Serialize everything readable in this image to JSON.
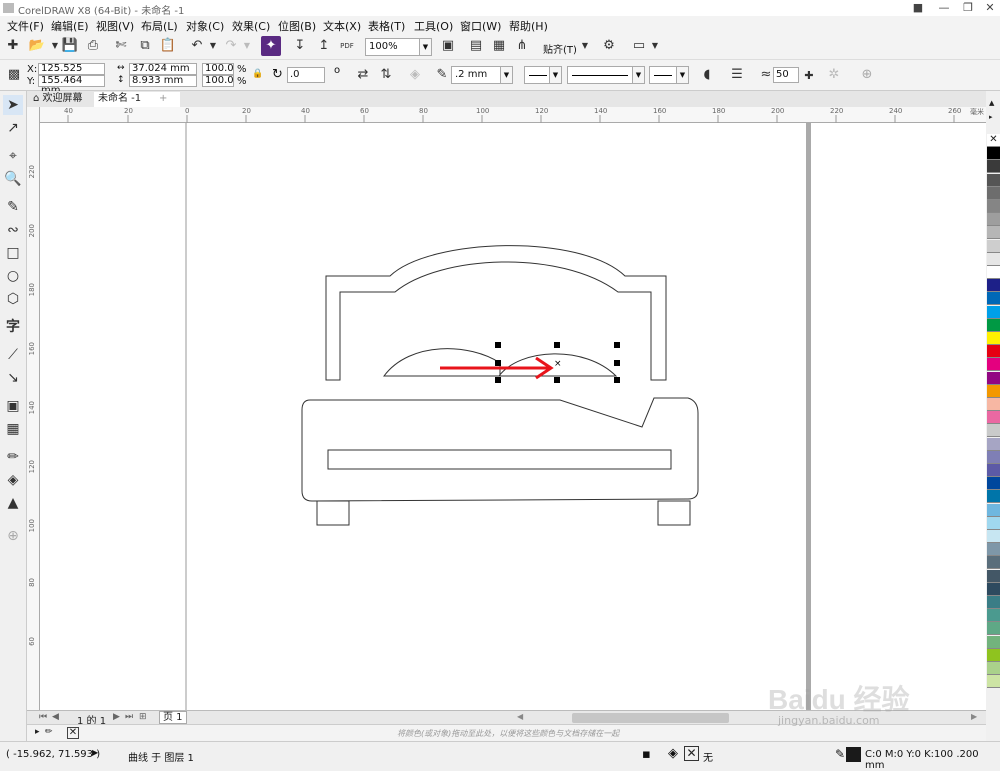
{
  "window": {
    "title": "CorelDRAW X8 (64-Bit) - 未命名 -1"
  },
  "menu": [
    "文件(F)",
    "编辑(E)",
    "视图(V)",
    "布局(L)",
    "对象(C)",
    "效果(C)",
    "位图(B)",
    "文本(X)",
    "表格(T)",
    "工具(O)",
    "窗口(W)",
    "帮助(H)"
  ],
  "toolbar": {
    "zoom": "100%",
    "snap_label": "贴齐(T)",
    "pdf_label": "PDF"
  },
  "propbar": {
    "x": "125.525 mm",
    "y": "155.464 mm",
    "w": "37.024 mm",
    "h": "8.933 mm",
    "sx": "100.0",
    "sy": "100.0",
    "pct": "%",
    "xlabel": "X:",
    "ylabel": "Y:",
    "rotation": ".0",
    "deg": "o",
    "outline_width": ".2 mm",
    "smooth": "50"
  },
  "tabs": {
    "welcome": "欢迎屏幕",
    "doc": "未命名 -1",
    "add": "+"
  },
  "ruler": {
    "h_ticks": [
      "40",
      "20",
      "0",
      "20",
      "40",
      "60",
      "80",
      "100",
      "120",
      "140",
      "160",
      "180",
      "200",
      "220",
      "240",
      "260"
    ],
    "v_ticks": [
      "220",
      "200",
      "180",
      "160",
      "140",
      "120",
      "100",
      "80",
      "60"
    ],
    "unit": "毫米"
  },
  "pagenav": {
    "page_of": "1 的 1",
    "page_tab": "页 1"
  },
  "docpalette_hint": "将颜色(或对象)拖动至此处，以便将这些颜色与文档存储在一起",
  "status": {
    "coords": "( -15.962, 71.593 )",
    "object_info": "曲线 于 图层 1",
    "fill_none": "无",
    "outline_info": "C:0 M:0 Y:0 K:100  .200 mm"
  },
  "colors": {
    "accent_arrow": "#e8141b",
    "palette": [
      "#ffffff",
      "#000000",
      "#3a3a3a",
      "#555555",
      "#6d6d6d",
      "#858585",
      "#9e9e9e",
      "#b6b6b6",
      "#cecece",
      "#e6e6e6",
      "#ffffff",
      "#1d2088",
      "#0068b7",
      "#00a0e9",
      "#009944",
      "#fff100",
      "#e60012",
      "#e4007f",
      "#920783",
      "#f39800",
      "#f7b7a3",
      "#ea68a2",
      "#c9caca",
      "#a6a5c4",
      "#7f7fb5",
      "#5c5aa6",
      "#00479d",
      "#0075a9",
      "#6fb7df",
      "#a0d8ef",
      "#c7e6f2",
      "#7e97a8",
      "#5a6e7b",
      "#435766",
      "#2e4a5f",
      "#3a7d86",
      "#4b9a8f",
      "#5fa886",
      "#72b37d",
      "#8fc31f",
      "#aad18b",
      "#cde4a4"
    ]
  },
  "watermark": {
    "brand": "Baidu 经验",
    "url": "jingyan.baidu.com"
  }
}
